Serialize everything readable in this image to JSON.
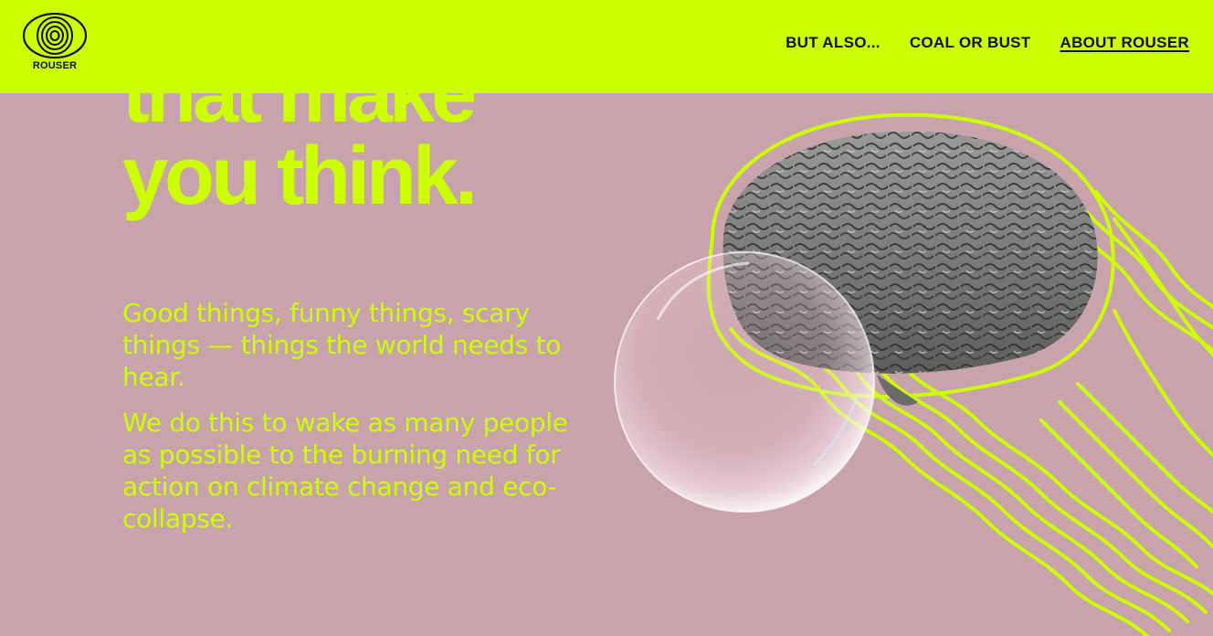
{
  "header": {
    "logo": {
      "icon": "concentric-rings-icon",
      "text": "ROUSER"
    },
    "nav": [
      {
        "label": "BUT ALSO...",
        "active": false
      },
      {
        "label": "COAL OR BUST",
        "active": false
      },
      {
        "label": "ABOUT ROUSER",
        "active": true
      }
    ]
  },
  "hero": {
    "heading_line_1": "that make",
    "heading_line_2": "you think.",
    "paragraph_1": "Good things, funny things, scary things — things the world needs to hear.",
    "paragraph_2": "We do this to wake as many people as possible to the burning need for action on climate change and eco-collapse."
  },
  "illustration": {
    "brain": "brain-image",
    "bubble": "soap-bubble-image",
    "waves": "wavy-lines-graphic"
  },
  "colors": {
    "accent": "#ccff00",
    "background": "#c9a3aa",
    "text_dark": "#111111"
  }
}
